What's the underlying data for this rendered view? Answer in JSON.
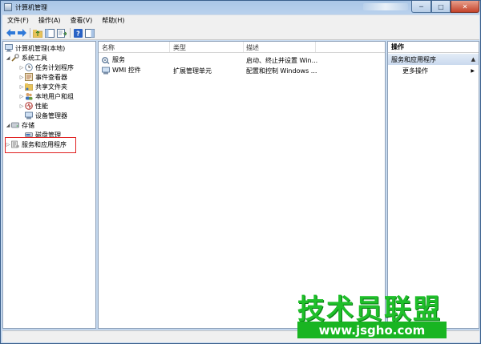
{
  "window": {
    "title": "计算机管理",
    "controls": {
      "minimize": "─",
      "maximize": "□",
      "close": "✕"
    }
  },
  "menubar": {
    "items": [
      "文件(F)",
      "操作(A)",
      "查看(V)",
      "帮助(H)"
    ]
  },
  "toolbar": {
    "icons": [
      "back-icon",
      "forward-icon",
      "up-folder-icon",
      "show-hide-tree-icon",
      "export-list-icon",
      "help-icon",
      "show-hide-action-pane-icon"
    ]
  },
  "tree": {
    "root": "计算机管理(本地)",
    "system_tools": "系统工具",
    "task_scheduler": "任务计划程序",
    "event_viewer": "事件查看器",
    "shared_folders": "共享文件夹",
    "local_users": "本地用户和组",
    "performance": "性能",
    "device_manager": "设备管理器",
    "storage": "存储",
    "disk_management": "磁盘管理",
    "services_apps": "服务和应用程序"
  },
  "list": {
    "columns": [
      "名称",
      "类型",
      "描述"
    ],
    "rows": [
      {
        "name": "服务",
        "type": "",
        "desc": "启动、终止并设置 Win..."
      },
      {
        "name": "WMI 控件",
        "type": "扩展管理单元",
        "desc": "配置和控制 Windows ..."
      }
    ]
  },
  "actions": {
    "title": "操作",
    "section": "服务和应用程序",
    "more": "更多操作"
  },
  "watermark": {
    "title": "技术员联盟",
    "url": "www.jsgho.com"
  },
  "colors": {
    "highlight_box": "#e02020",
    "watermark_green": "#1fbf2a",
    "section_header": "#c9d9ee"
  }
}
